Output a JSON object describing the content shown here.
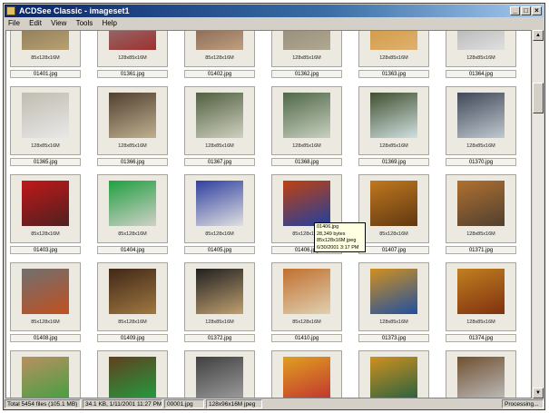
{
  "window": {
    "title": "ACDSee Classic - imageset1"
  },
  "menu": [
    "File",
    "Edit",
    "View",
    "Tools",
    "Help"
  ],
  "rows": [
    {
      "tiles": [
        {
          "dims": "85x128x16M",
          "name": "01401.jpg",
          "colors": [
            "#7a6a50",
            "#b8a070"
          ]
        },
        {
          "dims": "128x85x16M",
          "name": "01361.jpg",
          "colors": [
            "#8a8a8a",
            "#a03030"
          ]
        },
        {
          "dims": "85x128x16M",
          "name": "01402.jpg",
          "colors": [
            "#6a4a3a",
            "#c0a080"
          ]
        },
        {
          "dims": "128x85x16M",
          "name": "01362.jpg",
          "colors": [
            "#8a8070",
            "#b0a890"
          ]
        },
        {
          "dims": "128x85x16M",
          "name": "01363.jpg",
          "colors": [
            "#c89030",
            "#e0b070"
          ]
        },
        {
          "dims": "128x85x16M",
          "name": "01364.jpg",
          "colors": [
            "#a0a0a0",
            "#e0e0e0"
          ]
        }
      ]
    },
    {
      "tiles": [
        {
          "dims": "128x85x16M",
          "name": "01365.jpg",
          "colors": [
            "#c0bcb0",
            "#e8e8e8"
          ]
        },
        {
          "dims": "128x85x16M",
          "name": "01366.jpg",
          "colors": [
            "#504030",
            "#c0b090"
          ]
        },
        {
          "dims": "128x85x16M",
          "name": "01367.jpg",
          "colors": [
            "#506040",
            "#d0d0c0"
          ]
        },
        {
          "dims": "128x85x16M",
          "name": "01368.jpg",
          "colors": [
            "#506848",
            "#c8d0c0"
          ]
        },
        {
          "dims": "128x85x16M",
          "name": "01369.jpg",
          "colors": [
            "#405030",
            "#d0e0e0"
          ]
        },
        {
          "dims": "128x85x16M",
          "name": "01370.jpg",
          "colors": [
            "#404858",
            "#c0c8d0"
          ]
        }
      ]
    },
    {
      "tiles": [
        {
          "dims": "85x128x16M",
          "name": "01403.jpg",
          "colors": [
            "#c01818",
            "#502020"
          ]
        },
        {
          "dims": "85x128x16M",
          "name": "01404.jpg",
          "colors": [
            "#20a040",
            "#d0d0c8"
          ]
        },
        {
          "dims": "85x128x16M",
          "name": "01405.jpg",
          "colors": [
            "#3040a0",
            "#e0e0e0"
          ]
        },
        {
          "dims": "85x128x16M",
          "name": "01406.jpg",
          "colors": [
            "#c04010",
            "#2040a0"
          ]
        },
        {
          "dims": "85x128x16M",
          "name": "01407.jpg",
          "colors": [
            "#c07820",
            "#603810"
          ]
        },
        {
          "dims": "128x85x16M",
          "name": "01371.jpg",
          "colors": [
            "#b07030",
            "#504030"
          ]
        }
      ]
    },
    {
      "tiles": [
        {
          "dims": "85x128x16M",
          "name": "01408.jpg",
          "colors": [
            "#707070",
            "#c05020"
          ]
        },
        {
          "dims": "85x128x16M",
          "name": "01409.jpg",
          "colors": [
            "#402818",
            "#a07840"
          ]
        },
        {
          "dims": "128x85x16M",
          "name": "01372.jpg",
          "colors": [
            "#202020",
            "#c0a070"
          ]
        },
        {
          "dims": "85x128x16M",
          "name": "01410.jpg",
          "colors": [
            "#c07030",
            "#e0d0b0"
          ]
        },
        {
          "dims": "128x85x16M",
          "name": "01373.jpg",
          "colors": [
            "#d09020",
            "#2050a0"
          ]
        },
        {
          "dims": "128x85x16M",
          "name": "01374.jpg",
          "colors": [
            "#c08020",
            "#803010"
          ]
        }
      ]
    },
    {
      "tiles": [
        {
          "dims": "",
          "name": "",
          "colors": [
            "#b89060",
            "#40a040"
          ]
        },
        {
          "dims": "",
          "name": "",
          "colors": [
            "#604020",
            "#20a040"
          ]
        },
        {
          "dims": "",
          "name": "",
          "colors": [
            "#404040",
            "#a0a0a0"
          ]
        },
        {
          "dims": "",
          "name": "",
          "colors": [
            "#e0a020",
            "#c03030"
          ]
        },
        {
          "dims": "",
          "name": "",
          "colors": [
            "#d09020",
            "#206040"
          ]
        },
        {
          "dims": "",
          "name": "",
          "colors": [
            "#705030",
            "#c0c0c0"
          ]
        }
      ]
    }
  ],
  "tooltip": {
    "line1": "01406.jpg",
    "line2": "28,349 bytes",
    "line3": "85x128x16M jpeg",
    "line4": "6/30/2001 3:17 PM"
  },
  "status": {
    "total": "Total 5454 files (105.1 MB)",
    "selected": "34.1 KB, 1/11/2001 11:27 PM",
    "file": "00001.jpg",
    "format": "128x96x16M jpeg",
    "state": "Processing..."
  },
  "colors": {
    "title_start": "#0a246a",
    "title_end": "#a6caf0",
    "tooltip_bg": "#ffffe1",
    "chrome": "#d4d0c8"
  }
}
